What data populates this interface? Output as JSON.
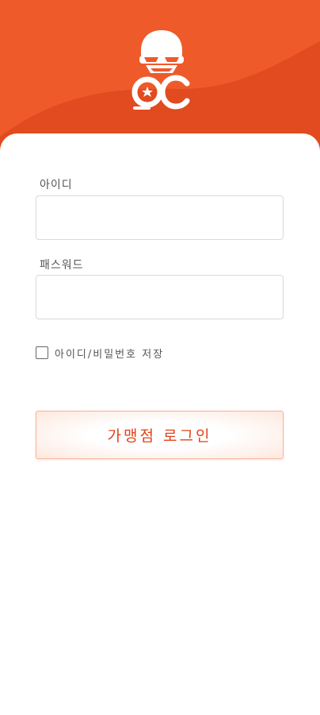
{
  "brand": {
    "logo_text": "OC",
    "colors": {
      "header": "#ef5a2a",
      "header_dark": "#e14b1f",
      "button_text": "#e0431a",
      "button_border": "#f3b49c"
    }
  },
  "form": {
    "id_label": "아이디",
    "id_value": "",
    "password_label": "패스워드",
    "password_value": "",
    "remember_label": "아이디/비밀번호 저장",
    "remember_checked": false,
    "login_button": "가맹점 로그인"
  }
}
